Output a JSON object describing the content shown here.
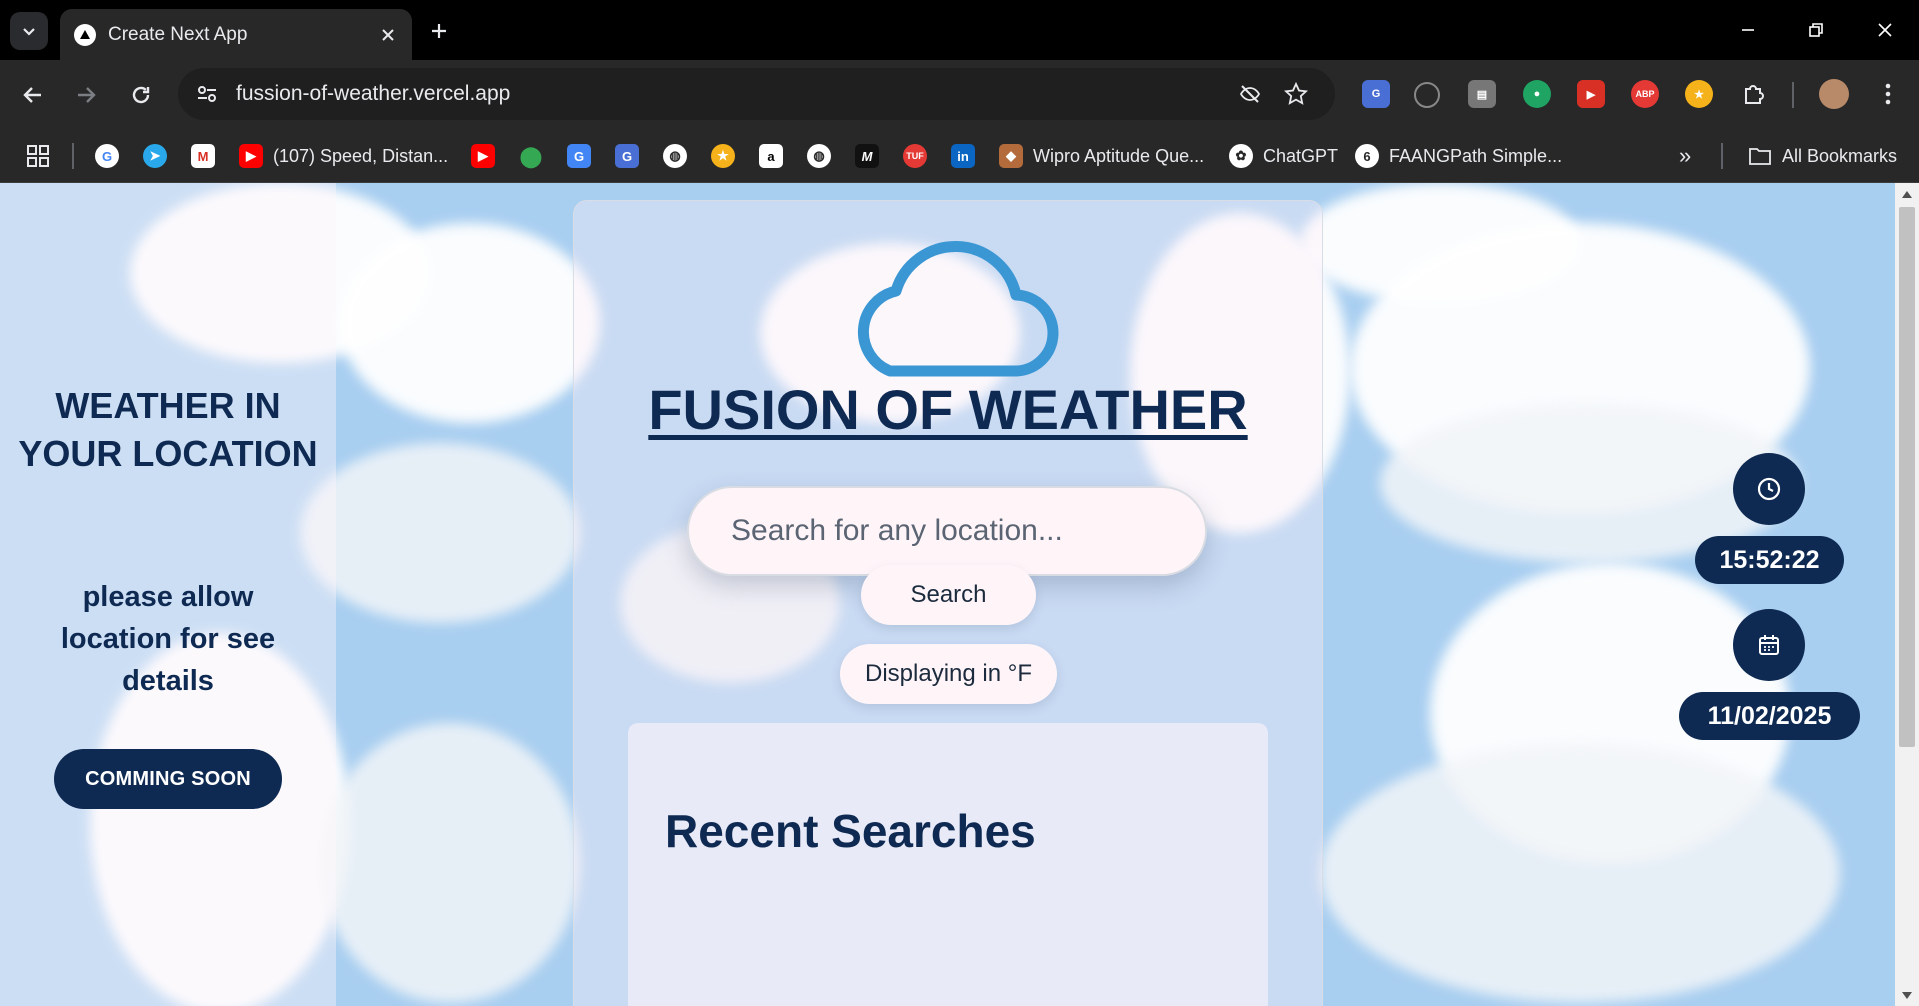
{
  "browser": {
    "tab": {
      "title": "Create Next App",
      "favicon_icon": "vercel-triangle-icon"
    },
    "url": "fussion-of-weather.vercel.app",
    "bookmarks": [
      {
        "label": "(107) Speed, Distan...",
        "icon": "youtube-icon"
      },
      {
        "label": "Wipro Aptitude Que...",
        "icon": "cow-icon"
      },
      {
        "label": "ChatGPT",
        "icon": "chatgpt-icon"
      },
      {
        "label": "FAANGPath Simple...",
        "icon": "faangpath-icon"
      }
    ],
    "all_bookmarks_label": "All Bookmarks",
    "overflow_label": "»"
  },
  "left_panel": {
    "title": "WEATHER IN YOUR LOCATION",
    "subtitle": "please allow location for see details",
    "button_label": "COMMING SOON"
  },
  "main": {
    "brand_title": "FUSION OF WEATHER",
    "search_placeholder": "Search for any location...",
    "search_button_label": "Search",
    "unit_toggle_label": "Displaying in °F",
    "recent_title": "Recent Searches"
  },
  "right_panel": {
    "time": "15:52:22",
    "date": "11/02/2025"
  },
  "colors": {
    "navy": "#0e2a52",
    "sky": "#a8cef0",
    "cloud_icon": "#3a97d4"
  }
}
